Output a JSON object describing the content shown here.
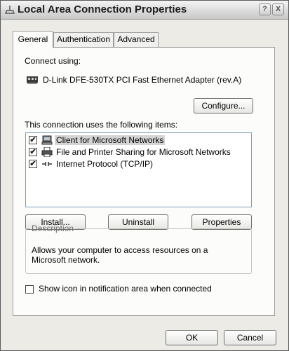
{
  "window": {
    "title": "Local Area Connection Properties",
    "help_glyph": "?",
    "close_glyph": "X"
  },
  "tabs": [
    {
      "label": "General",
      "active": true
    },
    {
      "label": "Authentication",
      "active": false
    },
    {
      "label": "Advanced",
      "active": false
    }
  ],
  "general": {
    "connect_using_label": "Connect using:",
    "adapter_name": "D-Link DFE-530TX PCI Fast Ethernet Adapter (rev.A)",
    "configure_button": "Configure...",
    "items_label": "This connection uses the following items:",
    "items": [
      {
        "label": "Client for Microsoft Networks",
        "checked": true,
        "selected": true,
        "icon": "network-client-icon"
      },
      {
        "label": "File and Printer Sharing for Microsoft Networks",
        "checked": true,
        "selected": false,
        "icon": "printer-icon"
      },
      {
        "label": "Internet Protocol (TCP/IP)",
        "checked": true,
        "selected": false,
        "icon": "protocol-icon"
      }
    ],
    "install_button": "Install...",
    "uninstall_button": "Uninstall",
    "properties_button": "Properties",
    "description_legend": "Description",
    "description_text": "Allows your computer to access resources on a Microsoft network.",
    "show_icon_label": "Show icon in notification area when connected",
    "show_icon_checked": false
  },
  "footer": {
    "ok_button": "OK",
    "cancel_button": "Cancel"
  },
  "check_glyph": "✔"
}
